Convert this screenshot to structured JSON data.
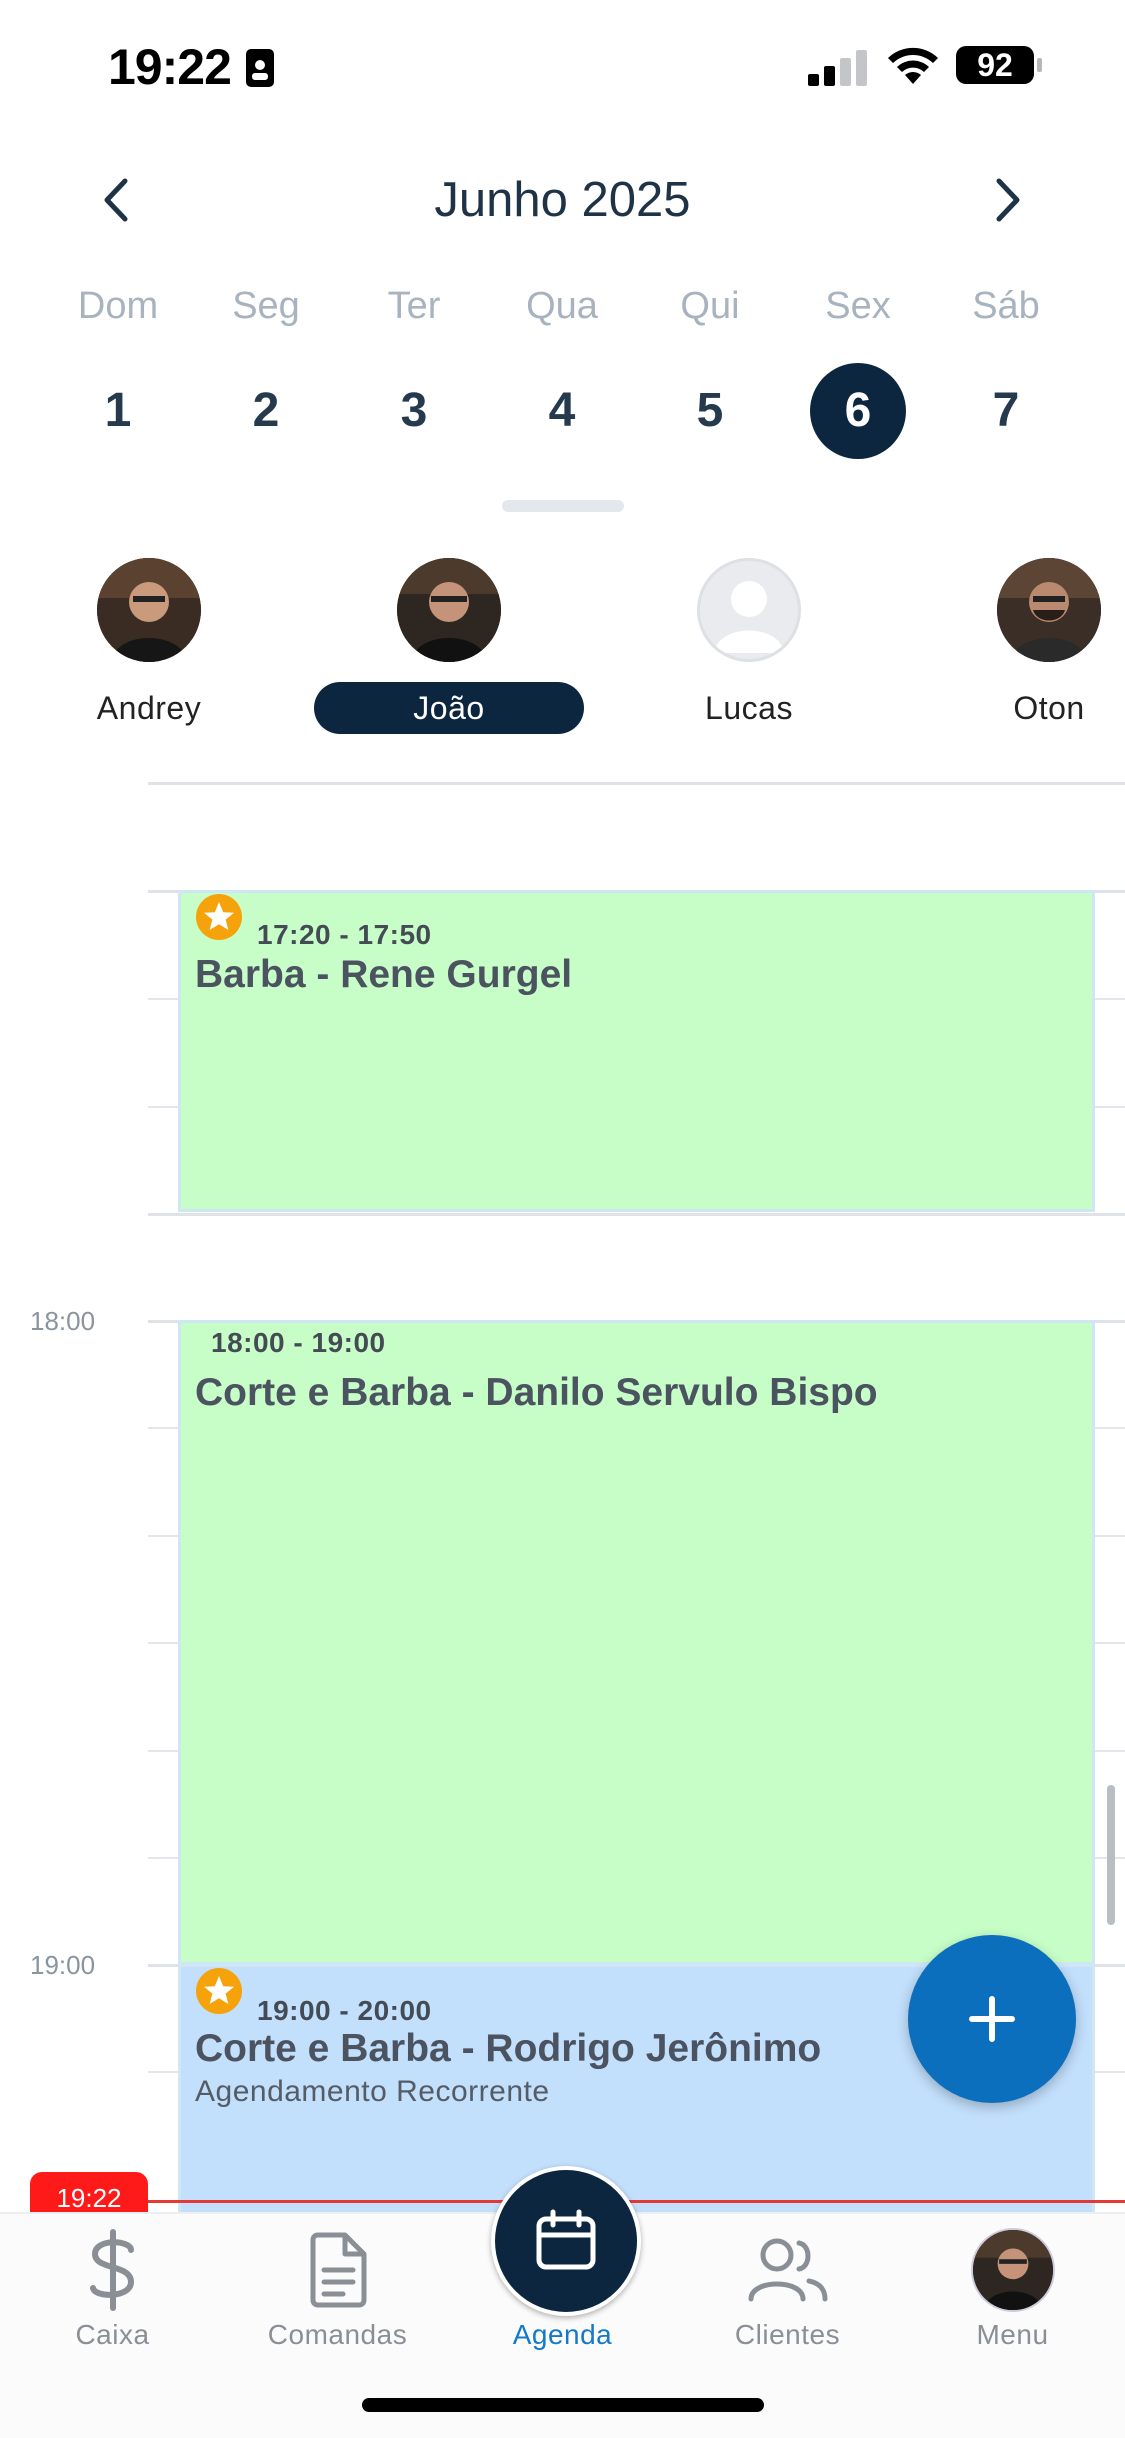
{
  "status_bar": {
    "time": "19:22",
    "battery": "92"
  },
  "calendar": {
    "month_title": "Junho 2025",
    "weekdays": [
      "Dom",
      "Seg",
      "Ter",
      "Qua",
      "Qui",
      "Sex",
      "Sáb"
    ],
    "days": [
      "1",
      "2",
      "3",
      "4",
      "5",
      "6",
      "7"
    ],
    "selected_day": "6"
  },
  "staff": [
    {
      "name": "Andrey"
    },
    {
      "name": "João",
      "selected": true
    },
    {
      "name": "Lucas"
    },
    {
      "name": "Oton"
    }
  ],
  "timeline": {
    "hours": [
      "18:00",
      "19:00"
    ],
    "now_label": "19:22",
    "events": [
      {
        "time": "17:20 - 17:50",
        "title": "Barba - Rene Gurgel",
        "subtitle": "",
        "color": "#c7fec7",
        "starred": true
      },
      {
        "time": "18:00 - 19:00",
        "title": "Corte e Barba - Danilo Servulo Bispo",
        "subtitle": "",
        "color": "#c7fec7",
        "starred": false
      },
      {
        "time": "19:00 - 20:00",
        "title": "Corte e Barba - Rodrigo Jerônimo",
        "subtitle": "Agendamento Recorrente",
        "color": "#c2dffc",
        "starred": true
      }
    ]
  },
  "fab_icon": "plus-icon",
  "bottom_nav": {
    "items": [
      {
        "label": "Caixa",
        "icon": "dollar-icon"
      },
      {
        "label": "Comandas",
        "icon": "document-icon"
      },
      {
        "label": "Agenda",
        "icon": "calendar-icon",
        "active": true
      },
      {
        "label": "Clientes",
        "icon": "users-icon"
      },
      {
        "label": "Menu",
        "icon": "avatar"
      }
    ]
  },
  "colors": {
    "primary_dark": "#0d2640",
    "accent_blue": "#1479c9",
    "now_red": "#ff1a1a",
    "star": "#f5a20b"
  }
}
